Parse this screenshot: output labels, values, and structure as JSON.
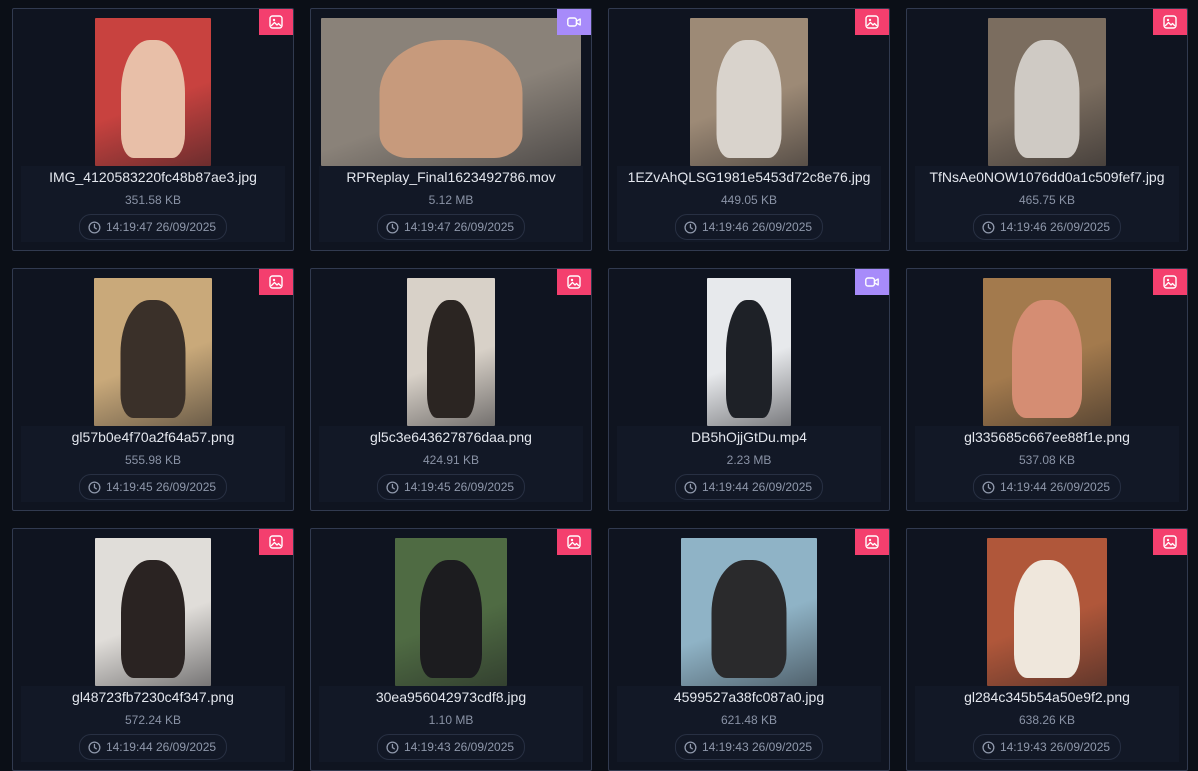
{
  "files": [
    {
      "name": "IMG_4120583220fc48b87ae3.jpg",
      "size": "351.58 KB",
      "time": "14:19:47 26/09/2025",
      "type": "image",
      "thumb_w": 116,
      "bg": "#c8423f",
      "fg": "#e8bfa8"
    },
    {
      "name": "RPReplay_Final1623492786.mov",
      "size": "5.12 MB",
      "time": "14:19:47 26/09/2025",
      "type": "video",
      "thumb_w": 260,
      "bg": "#8a8279",
      "fg": "#c79a7c"
    },
    {
      "name": "1EZvAhQLSG1981e5453d72c8e76.jpg",
      "size": "449.05 KB",
      "time": "14:19:46 26/09/2025",
      "type": "image",
      "thumb_w": 118,
      "bg": "#9d8a76",
      "fg": "#d9d3cc"
    },
    {
      "name": "TfNsAe0NOW1076dd0a1c509fef7.jpg",
      "size": "465.75 KB",
      "time": "14:19:46 26/09/2025",
      "type": "image",
      "thumb_w": 118,
      "bg": "#7b6d5f",
      "fg": "#cfcac4"
    },
    {
      "name": "gl57b0e4f70a2f64a57.png",
      "size": "555.98 KB",
      "time": "14:19:45 26/09/2025",
      "type": "image",
      "thumb_w": 118,
      "bg": "#c9a97a",
      "fg": "#3a3029"
    },
    {
      "name": "gl5c3e643627876daa.png",
      "size": "424.91 KB",
      "time": "14:19:45 26/09/2025",
      "type": "image",
      "thumb_w": 88,
      "bg": "#d8d1c8",
      "fg": "#2b2522"
    },
    {
      "name": "DB5hOjjGtDu.mp4",
      "size": "2.23 MB",
      "time": "14:19:44 26/09/2025",
      "type": "video",
      "thumb_w": 84,
      "bg": "#e7e9ec",
      "fg": "#1e2127"
    },
    {
      "name": "gl335685c667ee88f1e.png",
      "size": "537.08 KB",
      "time": "14:19:44 26/09/2025",
      "type": "image",
      "thumb_w": 128,
      "bg": "#a37a4d",
      "fg": "#d58d73"
    },
    {
      "name": "gl48723fb7230c4f347.png",
      "size": "572.24 KB",
      "time": "14:19:44 26/09/2025",
      "type": "image",
      "thumb_w": 116,
      "bg": "#e0ddd9",
      "fg": "#2a2322"
    },
    {
      "name": "30ea956042973cdf8.jpg",
      "size": "1.10 MB",
      "time": "14:19:43 26/09/2025",
      "type": "image",
      "thumb_w": 112,
      "bg": "#4f6b43",
      "fg": "#1c1c1f"
    },
    {
      "name": "4599527a38fc087a0.jpg",
      "size": "621.48 KB",
      "time": "14:19:43 26/09/2025",
      "type": "image",
      "thumb_w": 136,
      "bg": "#8fb3c6",
      "fg": "#2a2a2c"
    },
    {
      "name": "gl284c345b54a50e9f2.png",
      "size": "638.26 KB",
      "time": "14:19:43 26/09/2025",
      "type": "image",
      "thumb_w": 120,
      "bg": "#b0573a",
      "fg": "#efe7dc"
    }
  ]
}
